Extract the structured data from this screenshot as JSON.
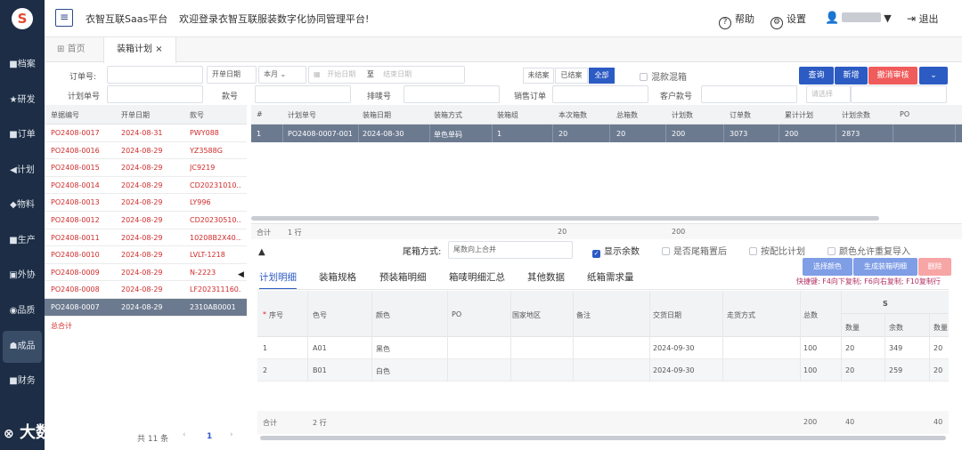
{
  "app": {
    "title": "衣智互联Saas平台",
    "welcome": "欢迎登录衣智互联服装数字化协同管理平台!",
    "logo_glyph": "S"
  },
  "header": {
    "help": "帮助",
    "settings": "设置",
    "logout": "退出"
  },
  "sidebar": {
    "items": [
      {
        "label": "■档案"
      },
      {
        "label": "★研发"
      },
      {
        "label": "■订单"
      },
      {
        "label": "◀计划"
      },
      {
        "label": "◆物料"
      },
      {
        "label": "■生产"
      },
      {
        "label": "▣外协"
      },
      {
        "label": "◉品质"
      },
      {
        "label": "☗成品"
      },
      {
        "label": "■财务"
      }
    ]
  },
  "tabs": {
    "home": "首页",
    "active": "装箱计划",
    "close": "×"
  },
  "filters": {
    "order_no": "订单号:",
    "open_date": "开单日期",
    "month": "本月",
    "start_date": "开始日期",
    "to": "至",
    "end_date": "结束日期",
    "status": [
      "未结案",
      "已结案",
      "全部"
    ],
    "mixed": "混款混箱",
    "plan_no": "计划单号",
    "style_no": "款号",
    "mark_no": "排唛号",
    "sales_order": "销售订单",
    "customer_style": "客户款号",
    "select": "请选择"
  },
  "buttons": {
    "query": "查询",
    "add": "新增",
    "cancel_audit": "撤消审核",
    "more": "⌄"
  },
  "left_table": {
    "headers": [
      "单据编号",
      "开单日期",
      "款号"
    ],
    "rows": [
      [
        "PO2408-0017",
        "2024-08-31",
        "PWY088"
      ],
      [
        "PO2408-0016",
        "2024-08-29",
        "YZ3588G"
      ],
      [
        "PO2408-0015",
        "2024-08-29",
        "JC9219"
      ],
      [
        "PO2408-0014",
        "2024-08-29",
        "CD20231010..."
      ],
      [
        "PO2408-0013",
        "2024-08-29",
        "LY996"
      ],
      [
        "PO2408-0012",
        "2024-08-29",
        "CD20230510..."
      ],
      [
        "PO2408-0011",
        "2024-08-29",
        "10208B2X40..."
      ],
      [
        "PO2408-0010",
        "2024-08-29",
        "LVLT-1218"
      ],
      [
        "PO2408-0009",
        "2024-08-29",
        "N-2223"
      ],
      [
        "PO2408-0008",
        "2024-08-29",
        "LF202311160..."
      ],
      [
        "PO2408-0007",
        "2024-08-29",
        "2310AB0001"
      ]
    ],
    "total_label": "总合计",
    "footer": {
      "count": "共 11 条",
      "page": "1",
      "prev": "‹",
      "next": "›"
    }
  },
  "main_table": {
    "headers": [
      "#",
      "计划单号",
      "装箱日期",
      "装箱方式",
      "装箱组",
      "本次箱数",
      "总箱数",
      "计划数",
      "订单数",
      "累计计划",
      "计划余数",
      "PO"
    ],
    "row": [
      "1",
      "PO2408-0007-001",
      "2024-08-30",
      "单色单码",
      "1",
      "20",
      "20",
      "200",
      "3073",
      "200",
      "2873",
      ""
    ],
    "summary": {
      "label": "合计",
      "rows": "1 行",
      "boxes": "20",
      "plan": "200"
    }
  },
  "options": {
    "tail_label": "尾箱方式:",
    "tail_value": "尾数向上合并",
    "show_remain": "显示余数",
    "tail_after": "是否尾箱置后",
    "by_ratio": "按配比计划",
    "color_dup": "颜色允许重复导入"
  },
  "sub_tabs": [
    "计划明细",
    "装箱规格",
    "预装箱明细",
    "箱唛明细汇总",
    "其他数据",
    "纸箱需求量"
  ],
  "detail_buttons": {
    "select_color": "选择颜色",
    "gen_detail": "生成装箱明细",
    "delete": "删除"
  },
  "shortcut": "快捷键: F4向下复制; F6向右复制; F10复制行",
  "detail_table": {
    "headers": [
      "序号",
      "色号",
      "颜色",
      "PO",
      "国家地区",
      "备注",
      "交货日期",
      "走货方式",
      "总数"
    ],
    "size": "S",
    "size_sub": [
      "数量",
      "余数",
      "数量"
    ],
    "rows": [
      [
        "1",
        "A01",
        "黑色",
        "",
        "",
        "",
        "2024-09-30",
        "",
        "100",
        "20",
        "349",
        "20"
      ],
      [
        "2",
        "B01",
        "白色",
        "",
        "",
        "",
        "2024-09-30",
        "",
        "100",
        "20",
        "259",
        "20"
      ]
    ],
    "summary": {
      "label": "合计",
      "rows": "2 行",
      "total": "200",
      "qty": "40",
      "qty2": "40"
    }
  },
  "watermark": "大数跨境"
}
